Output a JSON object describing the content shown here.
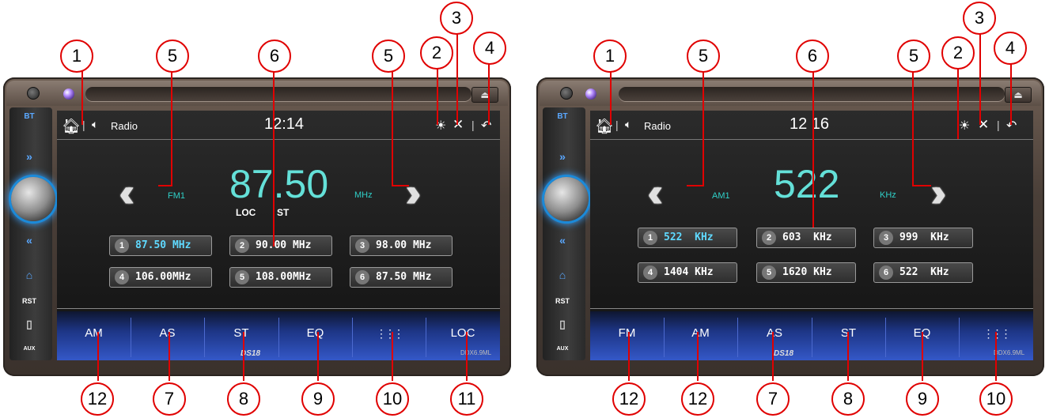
{
  "left_unit": {
    "side_buttons": [
      "BT",
      "»",
      "«",
      "⌂",
      "RST",
      "AUX"
    ],
    "status": {
      "source": "Radio",
      "time": "12:14"
    },
    "band": "FM1",
    "frequency": "87.50",
    "unit": "MHz",
    "flags": [
      "LOC",
      "ST"
    ],
    "presets": [
      {
        "num": "1",
        "freq": "87.50 MHz"
      },
      {
        "num": "2",
        "freq": "90.00 MHz"
      },
      {
        "num": "3",
        "freq": "98.00 MHz"
      },
      {
        "num": "4",
        "freq": "106.00MHz"
      },
      {
        "num": "5",
        "freq": "108.00MHz"
      },
      {
        "num": "6",
        "freq": "87.50 MHz"
      }
    ],
    "buttons": [
      "AM",
      "AS",
      "ST",
      "EQ",
      "⋮⋮⋮",
      "LOC"
    ],
    "brand": "DS18",
    "model": "DDX6.9ML",
    "callouts_top": [
      "1",
      "5",
      "6",
      "5",
      "2",
      "3",
      "4"
    ],
    "callouts_bottom": [
      "12",
      "7",
      "8",
      "9",
      "10",
      "11"
    ]
  },
  "right_unit": {
    "side_buttons": [
      "BT",
      "»",
      "«",
      "⌂",
      "RST",
      "AUX"
    ],
    "status": {
      "source": "Radio",
      "time": "12 16"
    },
    "band": "AM1",
    "frequency": "522",
    "unit": "KHz",
    "presets": [
      {
        "num": "1",
        "freq": "522  KHz"
      },
      {
        "num": "2",
        "freq": "603  KHz"
      },
      {
        "num": "3",
        "freq": "999  KHz"
      },
      {
        "num": "4",
        "freq": "1404 KHz"
      },
      {
        "num": "5",
        "freq": "1620 KHz"
      },
      {
        "num": "6",
        "freq": "522  KHz"
      }
    ],
    "buttons": [
      "FM",
      "AM",
      "AS",
      "ST",
      "EQ",
      "⋮⋮⋮"
    ],
    "brand": "DS18",
    "model": "DDX6.9ML",
    "callouts_top": [
      "1",
      "5",
      "6",
      "5",
      "2",
      "3",
      "4"
    ],
    "callouts_bottom": [
      "12",
      "12",
      "7",
      "8",
      "9",
      "10"
    ]
  }
}
